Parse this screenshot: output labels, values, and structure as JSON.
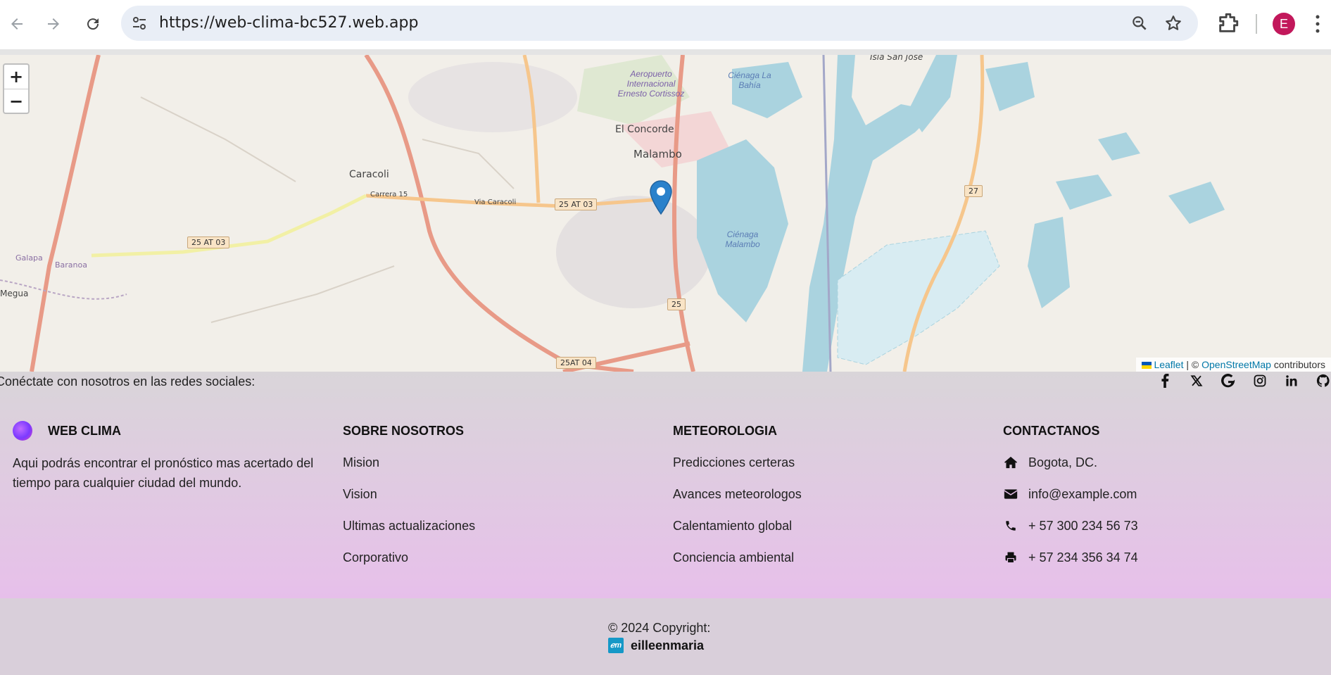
{
  "browser": {
    "url": "https://web-clima-bc527.web.app",
    "avatar_letter": "E"
  },
  "map": {
    "zoom_in": "+",
    "zoom_out": "−",
    "places": {
      "el_concorde": "El Concorde",
      "malambo": "Malambo",
      "caracoli": "Caracoli",
      "megua": "Megua",
      "isla_san_jose": "Isla San José",
      "aeropuerto": "Aeropuerto Internacional Ernesto Cortissoz",
      "cienaga_bahia": "Ciénaga La Bahía",
      "cienaga_malambo": "Ciénaga Malambo",
      "galapa": "Galapa",
      "baranoa": "Baranoa"
    },
    "roads": {
      "r1": "25 AT 03",
      "r2": "25 AT 03",
      "r3": "25AT 04",
      "r4": "25",
      "r5": "27",
      "via_caracoli": "Via Caracoli",
      "carrera15": "Carrera 15"
    },
    "attribution": {
      "leaflet": "Leaflet",
      "sep": "| ©",
      "osm": "OpenStreetMap",
      "contributors": "contributors"
    }
  },
  "footer": {
    "social_text": "Conéctate con nosotros en las redes sociales:",
    "social_icons": [
      "facebook-icon",
      "x-icon",
      "google-icon",
      "instagram-icon",
      "linkedin-icon",
      "github-icon"
    ],
    "brand": {
      "name": "WEB CLIMA",
      "description": "Aqui podrás encontrar el pronóstico mas acertado del tiempo para cualquier ciudad del mundo."
    },
    "sobre_nosotros": {
      "title": "SOBRE NOSOTROS",
      "links": [
        "Mision",
        "Vision",
        "Ultimas actualizaciones",
        "Corporativo"
      ]
    },
    "meteorologia": {
      "title": "METEOROLOGIA",
      "links": [
        "Predicciones certeras",
        "Avances meteorologos",
        "Calentamiento global",
        "Conciencia ambiental"
      ]
    },
    "contactanos": {
      "title": "CONTACTANOS",
      "items": [
        "Bogota, DC.",
        "info@example.com",
        "+ 57 300 234 56 73",
        "+ 57 234 356 34 74"
      ]
    },
    "copyright": "© 2024 Copyright:",
    "copyright_brand": "eilleenmaria",
    "copyright_logo": "ℯm"
  },
  "colors": {
    "marker": "#2a81cb",
    "link": "#0078a8",
    "avatar": "#c2185b"
  }
}
